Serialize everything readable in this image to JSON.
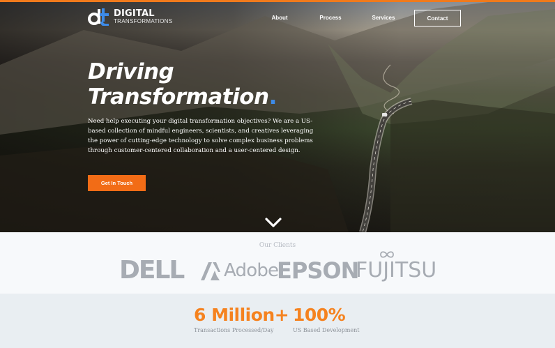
{
  "brand": {
    "logo_mark": "dt",
    "name_line1": "DIGITAL",
    "name_line2": "TRANSFORMATIONS",
    "accent_orange": "#f26c16",
    "accent_blue": "#3d8be8"
  },
  "nav": {
    "items": [
      "About",
      "Process",
      "Services"
    ],
    "contact": "Contact"
  },
  "hero": {
    "headline_line1": "Driving",
    "headline_line2": "Transformation",
    "headline_dot": ".",
    "intro": "Need help executing your digital transformation objectives? We are a US-based collection of mindful engineers, scientists, and creatives leveraging the power of cutting-edge technology to solve complex business problems through customer-centered collaboration and a user-centered design.",
    "cta_label": "Get In Touch",
    "scroll_icon": "chevron-down-icon"
  },
  "clients": {
    "label": "Our Clients",
    "logos": [
      "DELL",
      "Adobe",
      "EPSON",
      "FUJITSU"
    ]
  },
  "stats": [
    {
      "value": "6 Million+",
      "label": "Transactions Processed/Day"
    },
    {
      "value": "100%",
      "label": "US Based Development"
    }
  ]
}
